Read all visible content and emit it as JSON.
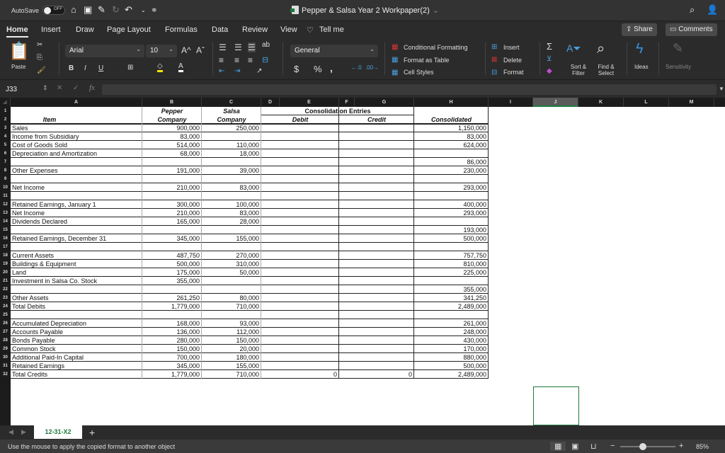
{
  "titlebar": {
    "autosave_label": "AutoSave",
    "autosave_state": "OFF",
    "document_title": "Pepper & Salsa Year 2 Workpaper(2)",
    "icons": [
      "home-icon",
      "save-icon",
      "edit-icon",
      "redo-icon",
      "undo-icon",
      "customize-icon",
      "search-icon",
      "account-icon"
    ]
  },
  "menu": {
    "tabs": [
      "Home",
      "Insert",
      "Draw",
      "Page Layout",
      "Formulas",
      "Data",
      "Review",
      "View"
    ],
    "active_tab": "Home",
    "tell_me": "Tell me",
    "share": "Share",
    "comments": "Comments"
  },
  "ribbon": {
    "paste": "Paste",
    "font_name": "Arial",
    "font_size": "10",
    "number_format": "General",
    "conditional_formatting": "Conditional Formatting",
    "format_as_table": "Format as Table",
    "cell_styles": "Cell Styles",
    "insert": "Insert",
    "delete": "Delete",
    "format": "Format",
    "sort_filter": "Sort & Filter",
    "find_select": "Find & Select",
    "ideas": "Ideas",
    "sensitivity": "Sensitivity",
    "bold": "B",
    "italic": "I",
    "underline": "U"
  },
  "formula_bar": {
    "name_box": "J33",
    "fx": "fx",
    "formula": ""
  },
  "columns": [
    "A",
    "B",
    "C",
    "D",
    "E",
    "F",
    "G",
    "H",
    "I",
    "J",
    "K",
    "L",
    "M"
  ],
  "selected_column": "J",
  "headers": {
    "row1_b": "Pepper",
    "row2_b": "Company",
    "row1_c": "Salsa",
    "row2_c": "Company",
    "consolidation": "Consolidation Entries",
    "debit": "Debit",
    "credit": "Credit",
    "consolidated": "Consolidated",
    "item": "Item"
  },
  "rows": [
    {
      "n": "3",
      "item": "Sales",
      "b": "900,000",
      "c": "250,000",
      "e": "",
      "g": "",
      "h": "1,150,000"
    },
    {
      "n": "4",
      "item": "Income from Subsidiary",
      "b": "83,000",
      "c": "",
      "e": "",
      "g": "",
      "h": "83,000"
    },
    {
      "n": "5",
      "item": "Cost of Goods Sold",
      "b": "514,000",
      "c": "110,000",
      "e": "",
      "g": "",
      "h": "624,000"
    },
    {
      "n": "6",
      "item": "Depreciation and Amortization",
      "b": "68,000",
      "c": "18,000",
      "e": "",
      "g": "",
      "h": ""
    },
    {
      "n": "7",
      "item": "",
      "b": "",
      "c": "",
      "e": "",
      "g": "",
      "h": "86,000"
    },
    {
      "n": "8",
      "item": "Other Expenses",
      "b": "191,000",
      "c": "39,000",
      "e": "",
      "g": "",
      "h": "230,000"
    },
    {
      "n": "9",
      "item": "",
      "b": "",
      "c": "",
      "e": "",
      "g": "",
      "h": ""
    },
    {
      "n": "10",
      "item": "Net Income",
      "b": "210,000",
      "c": "83,000",
      "e": "",
      "g": "",
      "h": "293,000"
    },
    {
      "n": "11",
      "item": "",
      "b": "",
      "c": "",
      "e": "",
      "g": "",
      "h": ""
    },
    {
      "n": "12",
      "item": "Retained Earnings, January 1",
      "b": "300,000",
      "c": "100,000",
      "e": "",
      "g": "",
      "h": "400,000"
    },
    {
      "n": "13",
      "item": "Net Income",
      "b": "210,000",
      "c": "83,000",
      "e": "",
      "g": "",
      "h": "293,000"
    },
    {
      "n": "14",
      "item": "Dividends Declared",
      "b": "165,000",
      "c": "28,000",
      "e": "",
      "g": "",
      "h": ""
    },
    {
      "n": "15",
      "item": "",
      "b": "",
      "c": "",
      "e": "",
      "g": "",
      "h": "193,000"
    },
    {
      "n": "16",
      "item": "Retained Earnings, December 31",
      "b": "345,000",
      "c": "155,000",
      "e": "",
      "g": "",
      "h": "500,000"
    },
    {
      "n": "17",
      "item": "",
      "b": "",
      "c": "",
      "e": "",
      "g": "",
      "h": ""
    },
    {
      "n": "18",
      "item": "Current Assets",
      "b": "487,750",
      "c": "270,000",
      "e": "",
      "g": "",
      "h": "757,750"
    },
    {
      "n": "19",
      "item": "Buildings & Equipment",
      "b": "500,000",
      "c": "310,000",
      "e": "",
      "g": "",
      "h": "810,000"
    },
    {
      "n": "20",
      "item": "Land",
      "b": "175,000",
      "c": "50,000",
      "e": "",
      "g": "",
      "h": "225,000"
    },
    {
      "n": "21",
      "item": "Investment in Salsa Co. Stock",
      "b": "355,000",
      "c": "",
      "e": "",
      "g": "",
      "h": ""
    },
    {
      "n": "22",
      "item": "",
      "b": "",
      "c": "",
      "e": "",
      "g": "",
      "h": "355,000"
    },
    {
      "n": "23",
      "item": "Other Assets",
      "b": "261,250",
      "c": "80,000",
      "e": "",
      "g": "",
      "h": "341,250"
    },
    {
      "n": "24",
      "item": "Total Debits",
      "b": "1,779,000",
      "c": "710,000",
      "e": "",
      "g": "",
      "h": "2,489,000"
    },
    {
      "n": "25",
      "item": "",
      "b": "",
      "c": "",
      "e": "",
      "g": "",
      "h": ""
    },
    {
      "n": "26",
      "item": "Accumulated Depreciation",
      "b": "168,000",
      "c": "93,000",
      "e": "",
      "g": "",
      "h": "261,000"
    },
    {
      "n": "27",
      "item": "Accounts Payable",
      "b": "136,000",
      "c": "112,000",
      "e": "",
      "g": "",
      "h": "248,000"
    },
    {
      "n": "28",
      "item": "Bonds Payable",
      "b": "280,000",
      "c": "150,000",
      "e": "",
      "g": "",
      "h": "430,000"
    },
    {
      "n": "29",
      "item": "Common Stock",
      "b": "150,000",
      "c": "20,000",
      "e": "",
      "g": "",
      "h": "170,000"
    },
    {
      "n": "30",
      "item": "Additional Paid-In Capital",
      "b": "700,000",
      "c": "180,000",
      "e": "",
      "g": "",
      "h": "880,000"
    },
    {
      "n": "31",
      "item": "Retained Earnings",
      "b": "345,000",
      "c": "155,000",
      "e": "",
      "g": "",
      "h": "500,000"
    },
    {
      "n": "32",
      "item": "Total Credits",
      "b": "1,779,000",
      "c": "710,000",
      "e": "0",
      "g": "0",
      "h": "2,489,000"
    }
  ],
  "sheet_tabs": {
    "active": "12-31-X2",
    "add": "+"
  },
  "status": {
    "message": "Use the mouse to apply the copied format to another object",
    "zoom": "85%"
  }
}
